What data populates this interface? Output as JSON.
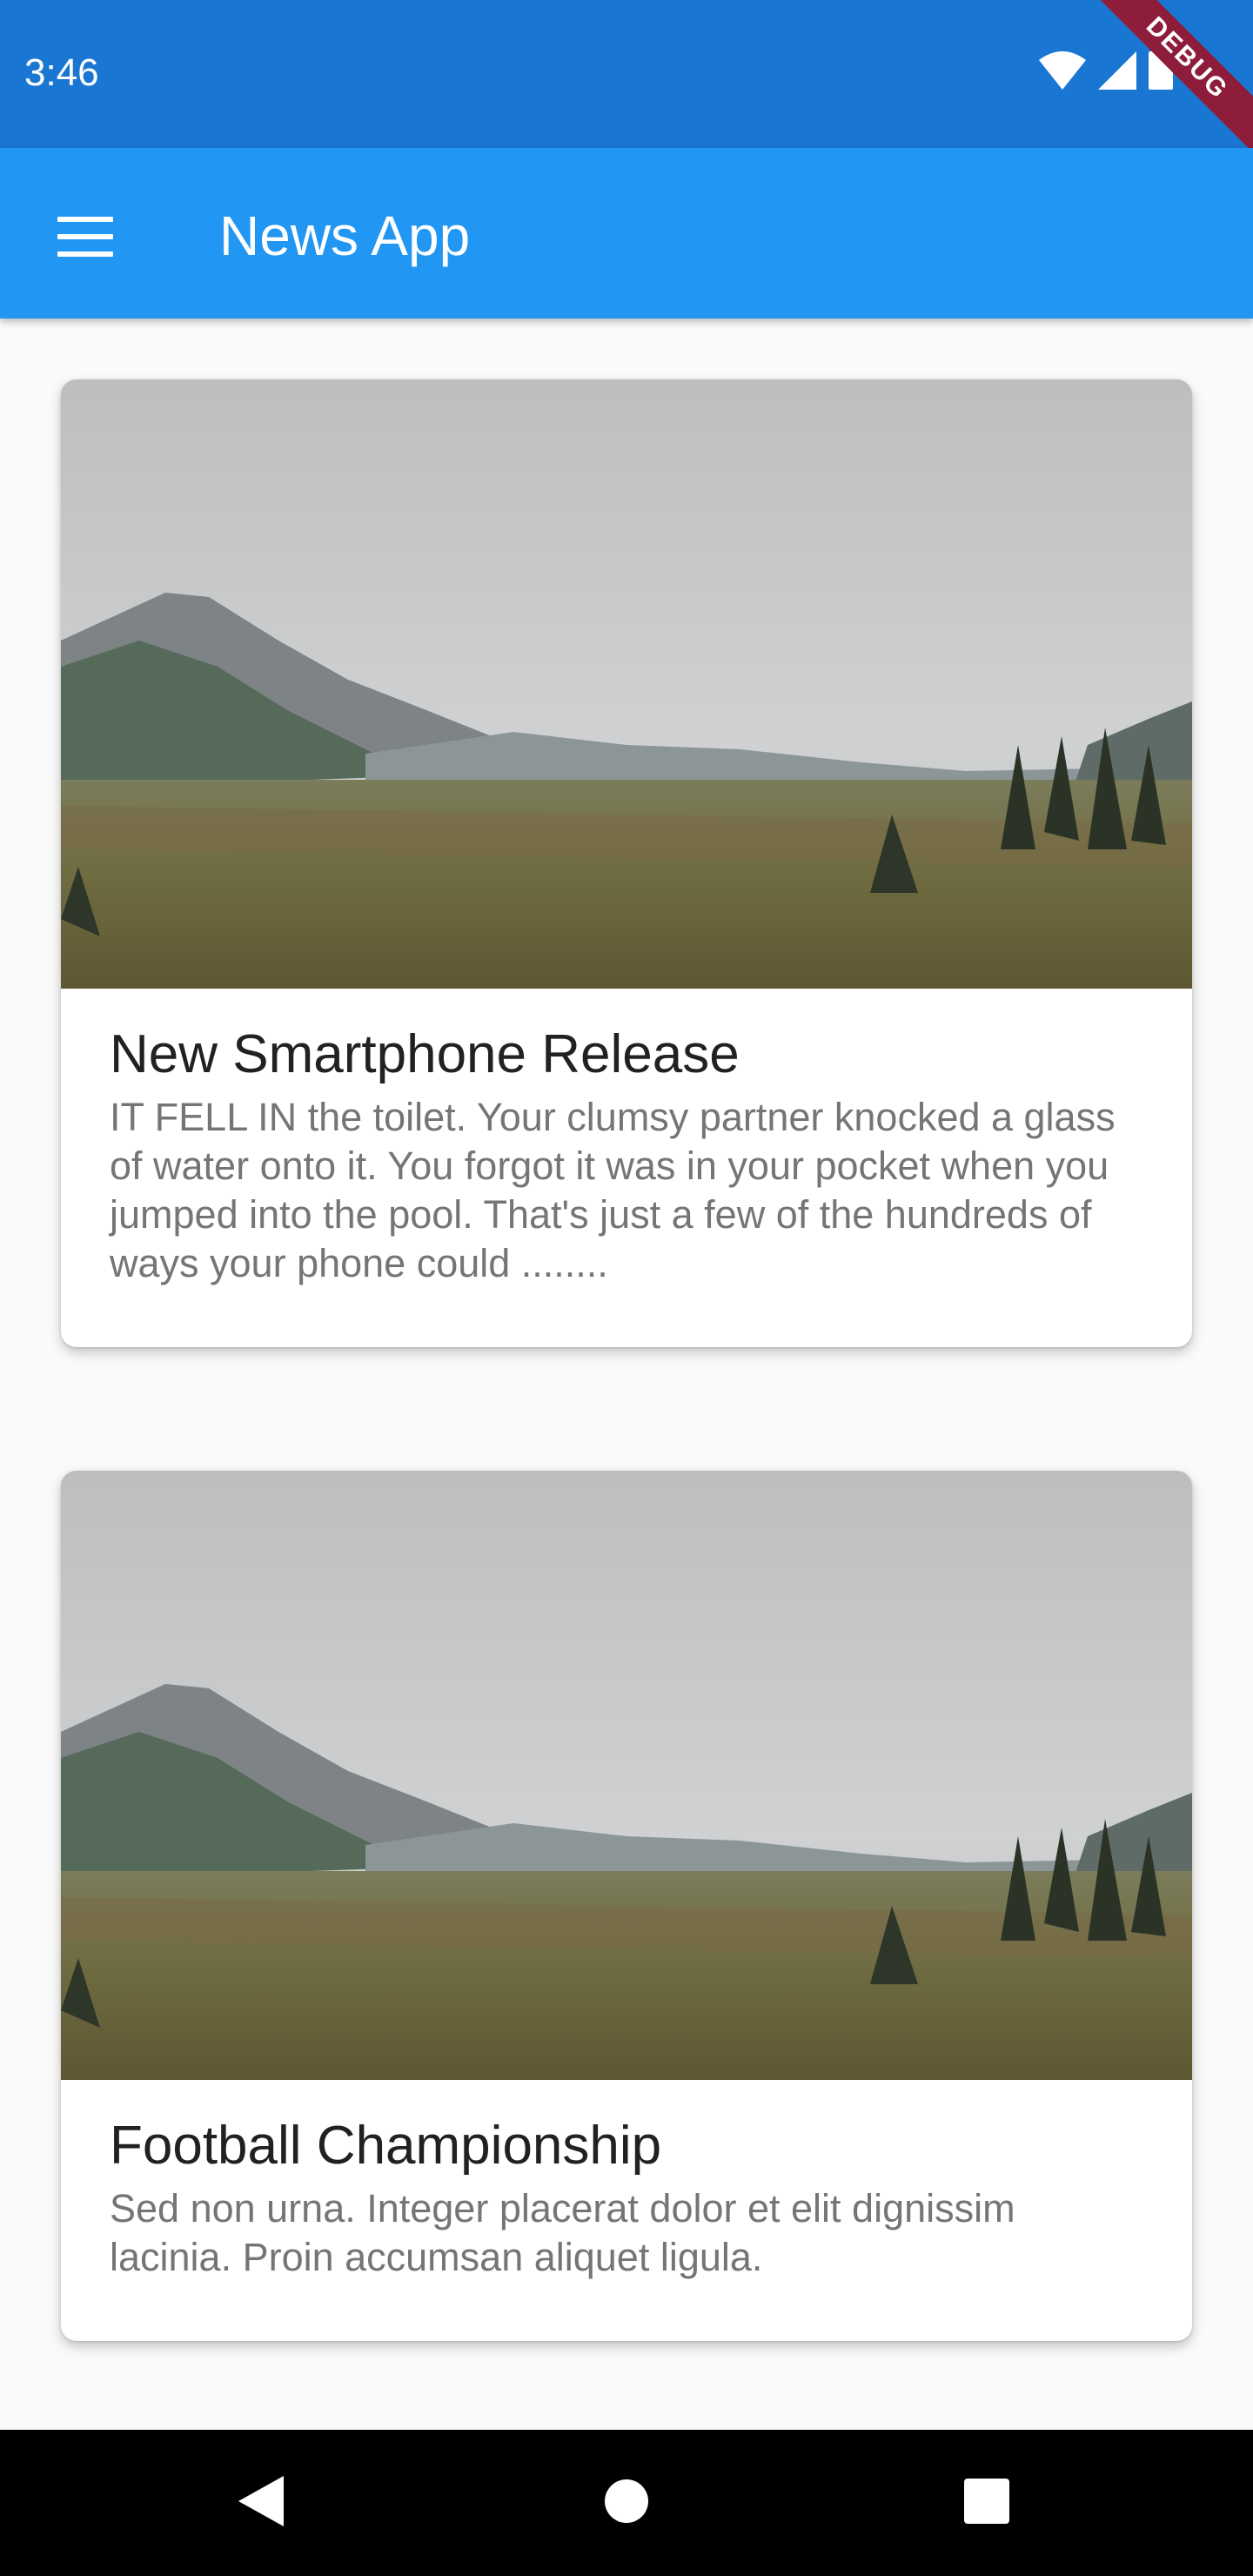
{
  "status_bar": {
    "time": "3:46",
    "icons": [
      "wifi-icon",
      "signal-icon",
      "battery-icon"
    ]
  },
  "debug_banner": {
    "label": "DEBUG"
  },
  "app_bar": {
    "menu_icon": "menu-icon",
    "title": "News App"
  },
  "articles": [
    {
      "image": "mountain-landscape-photo",
      "title": "New Smartphone Release",
      "description": "IT FELL IN the toilet. Your clumsy partner knocked a glass of water onto it. You forgot it was in your pocket when you jumped into the pool. That's just a few of the hundreds of ways your phone could ........"
    },
    {
      "image": "mountain-landscape-photo",
      "title": "Football Championship",
      "description": "Sed non urna. Integer placerat dolor et elit dignissim lacinia. Proin accumsan aliquet ligula."
    }
  ],
  "nav_bar": {
    "icons": [
      "back-icon",
      "home-icon",
      "recents-icon"
    ]
  },
  "colors": {
    "status_bar": "#1976d2",
    "app_bar": "#2196f3",
    "background": "#fafafa",
    "card_title": "#212121",
    "card_text": "#757575",
    "debug_ribbon": "#8d1d3a"
  }
}
